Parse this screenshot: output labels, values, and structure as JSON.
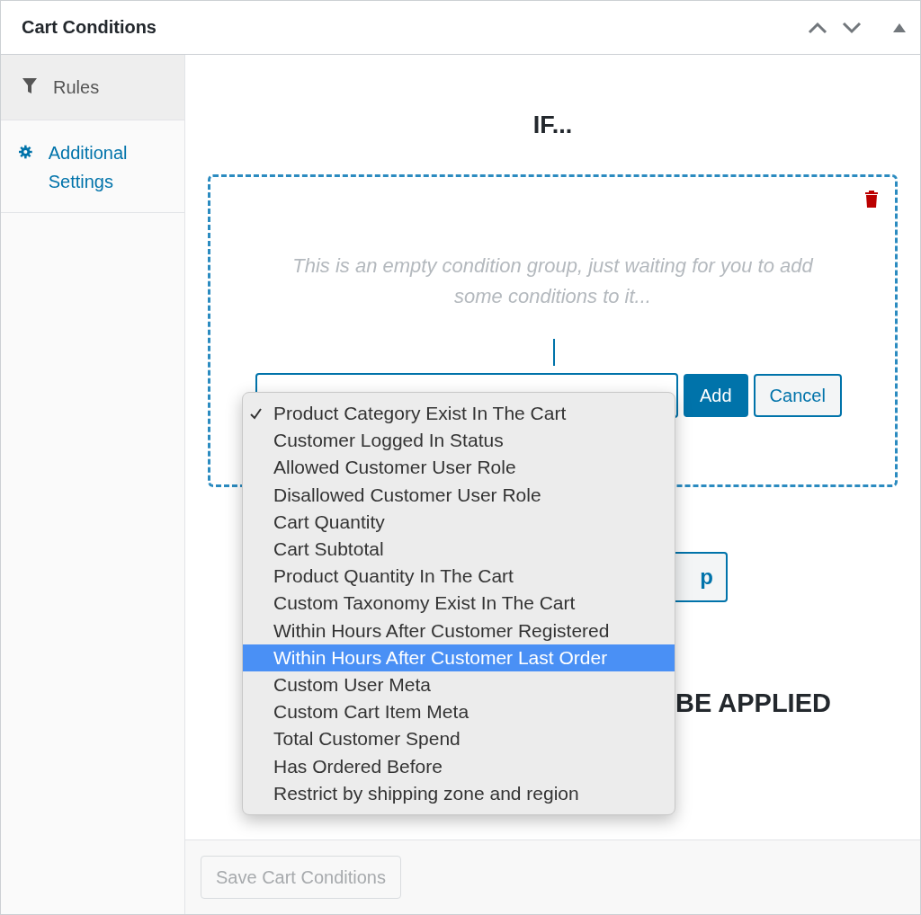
{
  "panel": {
    "title": "Cart Conditions"
  },
  "tabs": [
    {
      "label": "Rules",
      "selected": true
    },
    {
      "label": "Additional Settings",
      "selected": false
    }
  ],
  "heading": "IF...",
  "group": {
    "placeholder_text": "This is an empty condition group, just waiting for you to add some conditions to it...",
    "buttons": [
      {
        "label": "Add",
        "kind": "primary"
      },
      {
        "label": "Cancel",
        "kind": "secondary"
      }
    ]
  },
  "dropdown": {
    "options": [
      {
        "label": "Product Category Exist In The Cart",
        "checked": true,
        "selected": false
      },
      {
        "label": "Customer Logged In Status",
        "checked": false,
        "selected": false
      },
      {
        "label": "Allowed Customer User Role",
        "checked": false,
        "selected": false
      },
      {
        "label": "Disallowed Customer User Role",
        "checked": false,
        "selected": false
      },
      {
        "label": "Cart Quantity",
        "checked": false,
        "selected": false
      },
      {
        "label": "Cart Subtotal",
        "checked": false,
        "selected": false
      },
      {
        "label": "Product Quantity In The Cart",
        "checked": false,
        "selected": false
      },
      {
        "label": "Custom Taxonomy Exist In The Cart",
        "checked": false,
        "selected": false
      },
      {
        "label": "Within Hours After Customer Registered",
        "checked": false,
        "selected": false
      },
      {
        "label": "Within Hours After Customer Last Order",
        "checked": false,
        "selected": true
      },
      {
        "label": "Custom User Meta",
        "checked": false,
        "selected": false
      },
      {
        "label": "Custom Cart Item Meta",
        "checked": false,
        "selected": false
      },
      {
        "label": "Total Customer Spend",
        "checked": false,
        "selected": false
      },
      {
        "label": "Has Ordered Before",
        "checked": false,
        "selected": false
      },
      {
        "label": "Restrict by shipping zone and region",
        "checked": false,
        "selected": false
      }
    ]
  },
  "group_button": "p",
  "then_heading": "BE APPLIED",
  "footer": {
    "save_button": {
      "label": "Save Cart Conditions",
      "disabled": true
    }
  }
}
